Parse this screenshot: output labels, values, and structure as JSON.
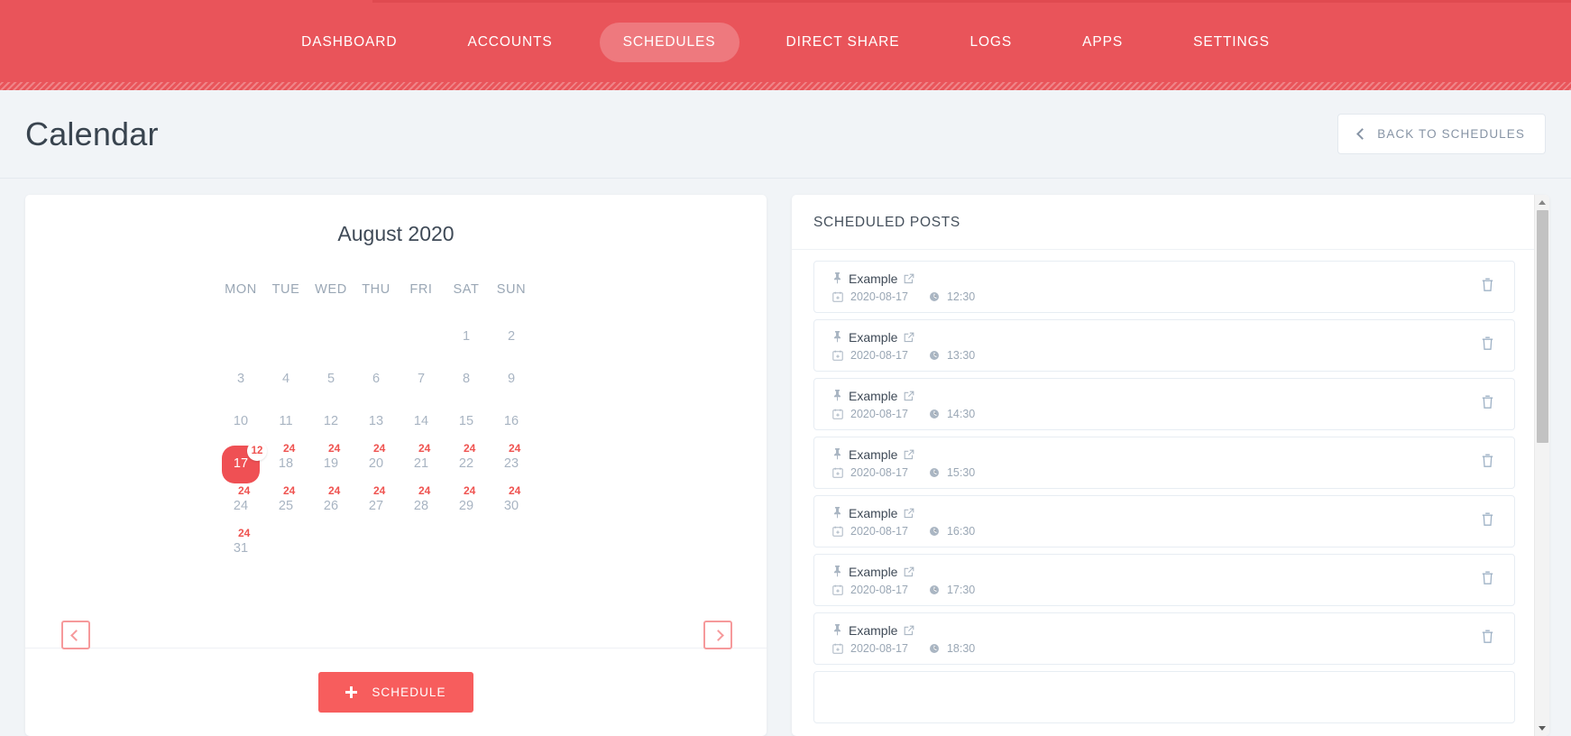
{
  "topnav": {
    "items": [
      {
        "label": "DASHBOARD",
        "active": false
      },
      {
        "label": "ACCOUNTS",
        "active": false
      },
      {
        "label": "SCHEDULES",
        "active": true
      },
      {
        "label": "DIRECT SHARE",
        "active": false
      },
      {
        "label": "LOGS",
        "active": false
      },
      {
        "label": "APPS",
        "active": false
      },
      {
        "label": "SETTINGS",
        "active": false
      }
    ],
    "bar_color": "#e9545a"
  },
  "pagehead": {
    "title": "Calendar",
    "back_label": "BACK TO SCHEDULES",
    "back_icon": "chevron-left-icon"
  },
  "calendar": {
    "month_label": "August 2020",
    "prev_icon": "chevron-left-icon",
    "next_icon": "chevron-right-icon",
    "accent_color": "#ef5054",
    "weekdays": [
      "MON",
      "TUE",
      "WED",
      "THU",
      "FRI",
      "SAT",
      "SUN"
    ],
    "weeks": [
      [
        {
          "day": "",
          "badge": "",
          "selected": false
        },
        {
          "day": "",
          "badge": "",
          "selected": false
        },
        {
          "day": "",
          "badge": "",
          "selected": false
        },
        {
          "day": "",
          "badge": "",
          "selected": false
        },
        {
          "day": "",
          "badge": "",
          "selected": false
        },
        {
          "day": "1",
          "badge": "",
          "selected": false
        },
        {
          "day": "2",
          "badge": "",
          "selected": false
        }
      ],
      [
        {
          "day": "3",
          "badge": "",
          "selected": false
        },
        {
          "day": "4",
          "badge": "",
          "selected": false
        },
        {
          "day": "5",
          "badge": "",
          "selected": false
        },
        {
          "day": "6",
          "badge": "",
          "selected": false
        },
        {
          "day": "7",
          "badge": "",
          "selected": false
        },
        {
          "day": "8",
          "badge": "",
          "selected": false
        },
        {
          "day": "9",
          "badge": "",
          "selected": false
        }
      ],
      [
        {
          "day": "10",
          "badge": "",
          "selected": false
        },
        {
          "day": "11",
          "badge": "",
          "selected": false
        },
        {
          "day": "12",
          "badge": "",
          "selected": false
        },
        {
          "day": "13",
          "badge": "",
          "selected": false
        },
        {
          "day": "14",
          "badge": "",
          "selected": false
        },
        {
          "day": "15",
          "badge": "",
          "selected": false
        },
        {
          "day": "16",
          "badge": "",
          "selected": false
        }
      ],
      [
        {
          "day": "17",
          "badge": "12",
          "selected": true
        },
        {
          "day": "18",
          "badge": "24",
          "selected": false
        },
        {
          "day": "19",
          "badge": "24",
          "selected": false
        },
        {
          "day": "20",
          "badge": "24",
          "selected": false
        },
        {
          "day": "21",
          "badge": "24",
          "selected": false
        },
        {
          "day": "22",
          "badge": "24",
          "selected": false
        },
        {
          "day": "23",
          "badge": "24",
          "selected": false
        }
      ],
      [
        {
          "day": "24",
          "badge": "24",
          "selected": false
        },
        {
          "day": "25",
          "badge": "24",
          "selected": false
        },
        {
          "day": "26",
          "badge": "24",
          "selected": false
        },
        {
          "day": "27",
          "badge": "24",
          "selected": false
        },
        {
          "day": "28",
          "badge": "24",
          "selected": false
        },
        {
          "day": "29",
          "badge": "24",
          "selected": false
        },
        {
          "day": "30",
          "badge": "24",
          "selected": false
        }
      ],
      [
        {
          "day": "31",
          "badge": "24",
          "selected": false
        },
        {
          "day": "",
          "badge": "",
          "selected": false
        },
        {
          "day": "",
          "badge": "",
          "selected": false
        },
        {
          "day": "",
          "badge": "",
          "selected": false
        },
        {
          "day": "",
          "badge": "",
          "selected": false
        },
        {
          "day": "",
          "badge": "",
          "selected": false
        },
        {
          "day": "",
          "badge": "",
          "selected": false
        }
      ]
    ],
    "schedule_button": {
      "label": "SCHEDULE",
      "icon": "plus-icon"
    }
  },
  "posts": {
    "heading": "SCHEDULED POSTS",
    "row_icons": {
      "pin": "pin-icon",
      "open": "external-link-icon",
      "date": "calendar-icon",
      "time": "clock-icon",
      "delete": "trash-icon"
    },
    "items": [
      {
        "title": "Example",
        "date": "2020-08-17",
        "time": "12:30"
      },
      {
        "title": "Example",
        "date": "2020-08-17",
        "time": "13:30"
      },
      {
        "title": "Example",
        "date": "2020-08-17",
        "time": "14:30"
      },
      {
        "title": "Example",
        "date": "2020-08-17",
        "time": "15:30"
      },
      {
        "title": "Example",
        "date": "2020-08-17",
        "time": "16:30"
      },
      {
        "title": "Example",
        "date": "2020-08-17",
        "time": "17:30"
      },
      {
        "title": "Example",
        "date": "2020-08-17",
        "time": "18:30"
      },
      {
        "title": "",
        "date": "",
        "time": ""
      }
    ]
  }
}
